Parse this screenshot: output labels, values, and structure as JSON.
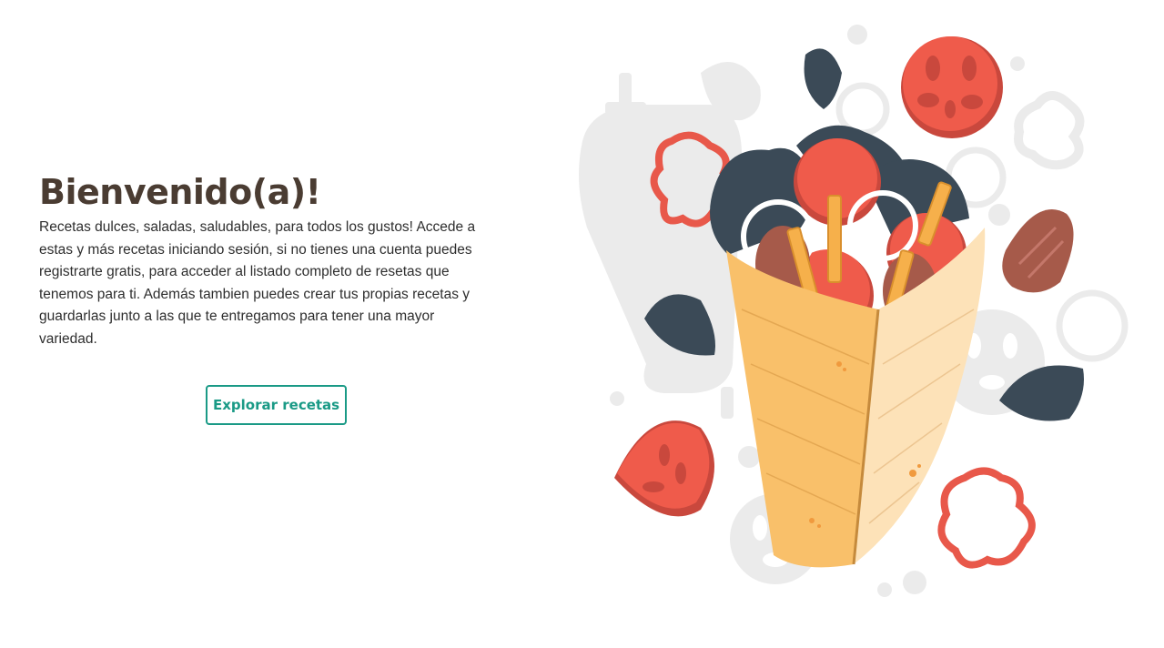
{
  "hero": {
    "title": "Bienvenido(a)!",
    "description": "Recetas dulces, saladas, saludables, para todos los gustos! Accede a estas y más recetas iniciando sesión, si no tienes una cuenta puedes registrarte gratis, para acceder al listado completo de resetas que tenemos para ti. Además tambien puedes crear tus propias recetas y guardarlas junto a las que te entregamos para tener una mayor variedad.",
    "cta_label": "Explorar recetas"
  },
  "illustration": {
    "subject": "wrap-with-tomato-onion-pepper-meat-illustration"
  },
  "colors": {
    "title": "#4a3c32",
    "accent": "#1a9a86",
    "tomato": "#e8584a",
    "wrap": "#f9c06a",
    "leaf": "#3b4a57"
  }
}
